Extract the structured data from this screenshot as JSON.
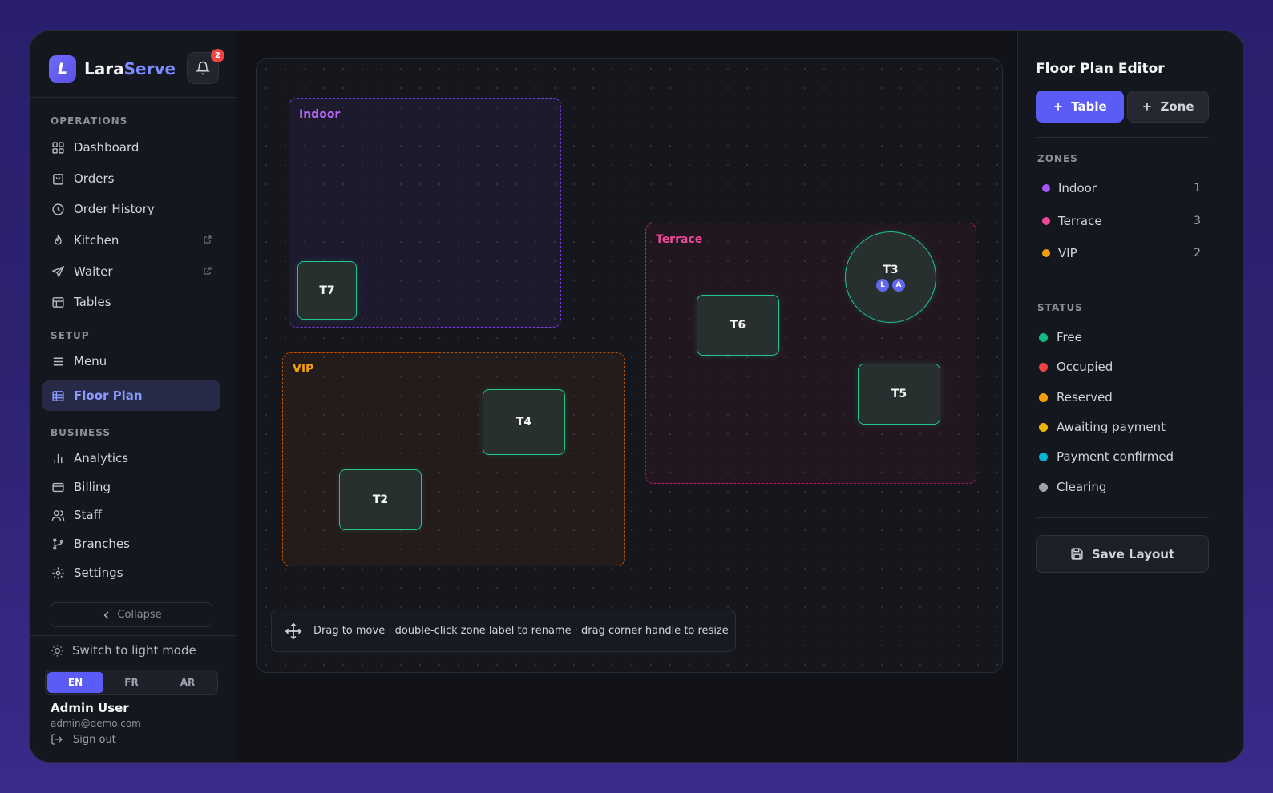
{
  "app": {
    "brand_main": "Lara",
    "brand_accent": "Serve",
    "logo_letter": "L",
    "notification_count": "2"
  },
  "sidebar": {
    "sections": {
      "operations": "OPERATIONS",
      "setup": "SETUP",
      "business": "BUSINESS"
    },
    "items": [
      {
        "label": "Dashboard",
        "icon": "grid-icon"
      },
      {
        "label": "Orders",
        "icon": "bag-icon"
      },
      {
        "label": "Order History",
        "icon": "clock-icon"
      },
      {
        "label": "Kitchen",
        "icon": "flame-icon",
        "external": true
      },
      {
        "label": "Waiter",
        "icon": "send-icon",
        "external": true
      },
      {
        "label": "Tables",
        "icon": "table-icon"
      },
      {
        "label": "Menu",
        "icon": "menu-icon"
      },
      {
        "label": "Floor Plan",
        "icon": "floor-plan-icon",
        "active": true
      },
      {
        "label": "Analytics",
        "icon": "bar-chart-icon"
      },
      {
        "label": "Billing",
        "icon": "card-icon"
      },
      {
        "label": "Staff",
        "icon": "users-icon"
      },
      {
        "label": "Branches",
        "icon": "branch-icon"
      },
      {
        "label": "Settings",
        "icon": "gear-icon"
      }
    ],
    "collapse_label": "Collapse",
    "theme_toggle": "Switch to light mode",
    "languages": [
      "EN",
      "FR",
      "AR"
    ],
    "active_language": "EN",
    "user": {
      "name": "Admin User",
      "email": "admin@demo.com",
      "sign_out": "Sign out"
    }
  },
  "canvas": {
    "zones": [
      {
        "label": "Indoor",
        "color": "#a855f7"
      },
      {
        "label": "Terrace",
        "color": "#ec4899"
      },
      {
        "label": "VIP",
        "color": "#f59e0b"
      }
    ],
    "tables": [
      {
        "label": "T7",
        "status_color": "#22c58a"
      },
      {
        "label": "T6",
        "status_color": "#22c58a"
      },
      {
        "label": "T3",
        "status_color": "#22c58a",
        "shape": "round",
        "avatars": [
          "L",
          "A"
        ]
      },
      {
        "label": "T5",
        "status_color": "#22c58a"
      },
      {
        "label": "T4",
        "status_color": "#22c58a"
      },
      {
        "label": "T2",
        "status_color": "#22c58a"
      }
    ],
    "hint": "Drag to move · double-click zone label to rename · drag corner handle to resize"
  },
  "editor": {
    "title": "Floor Plan Editor",
    "add_table": "Table",
    "add_zone": "Zone",
    "zones_heading": "ZONES",
    "zones": [
      {
        "name": "Indoor",
        "count": "1",
        "color": "#a855f7"
      },
      {
        "name": "Terrace",
        "count": "3",
        "color": "#ec4899"
      },
      {
        "name": "VIP",
        "count": "2",
        "color": "#f59e0b"
      }
    ],
    "status_heading": "STATUS",
    "statuses": [
      {
        "name": "Free",
        "color": "#10b981"
      },
      {
        "name": "Occupied",
        "color": "#ef4444"
      },
      {
        "name": "Reserved",
        "color": "#f59e0b"
      },
      {
        "name": "Awaiting payment",
        "color": "#eab308"
      },
      {
        "name": "Payment confirmed",
        "color": "#06b6d4"
      },
      {
        "name": "Clearing",
        "color": "#9ca3af"
      }
    ],
    "save_label": "Save Layout"
  }
}
